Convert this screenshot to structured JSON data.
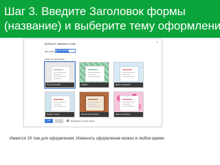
{
  "slide": {
    "title_line1": "Шаг 3. Введите Заголовок  формы",
    "title_line2": "(название) и выберите тему оформления",
    "footer": "Имеется 19 тем для  оформления. Изменить оформление можно в любое время",
    "banner_color": "#0aa43a"
  },
  "dialog": {
    "title": "Выберите название и тему",
    "close_icon": "close-icon",
    "name_label": "Заголовок",
    "name_value": "Новая форма",
    "theme_label": "Тема: По умолчанию",
    "themes": [
      {
        "label": "По умолчанию",
        "selected": true
      },
      {
        "label": "Ромбы",
        "selected": false
      },
      {
        "label": "День рождения",
        "selected": false
      },
      {
        "label": "Синие птицы",
        "selected": false
      },
      {
        "label": "Киноклассический",
        "selected": false
      },
      {
        "label": "Цветы розовые",
        "selected": false
      }
    ],
    "ok_label": "ОК",
    "cancel_label": "Отмена",
    "checkbox_label": "Показывать в списке форм",
    "accent_color": "#3d7ae0"
  }
}
